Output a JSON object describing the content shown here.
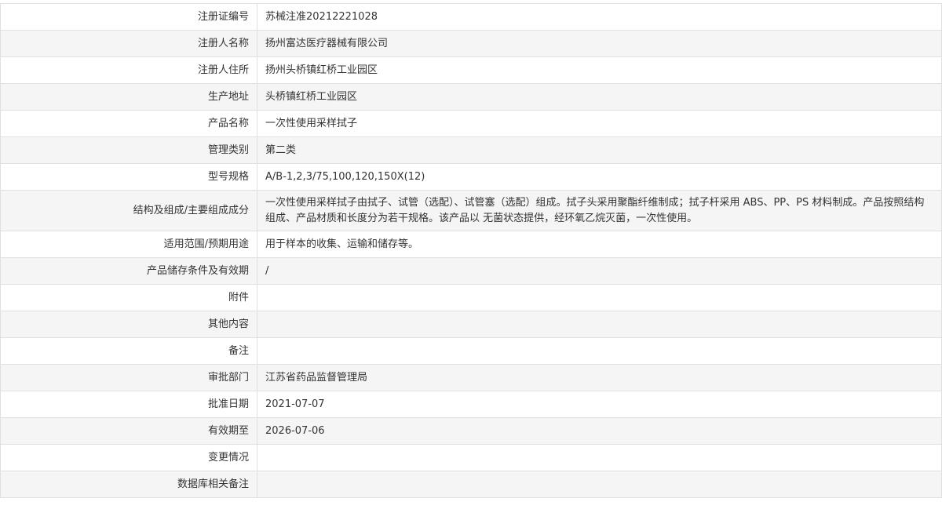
{
  "rows": [
    {
      "label": "注册证编号",
      "value": "苏械注准20212221028"
    },
    {
      "label": "注册人名称",
      "value": "扬州富达医疗器械有限公司"
    },
    {
      "label": "注册人住所",
      "value": "扬州头桥镇红桥工业园区"
    },
    {
      "label": "生产地址",
      "value": "头桥镇红桥工业园区"
    },
    {
      "label": "产品名称",
      "value": "一次性使用采样拭子"
    },
    {
      "label": "管理类别",
      "value": "第二类"
    },
    {
      "label": "型号规格",
      "value": "A/B-1,2,3/75,100,120,150X(12)"
    },
    {
      "label": "结构及组成/主要组成成分",
      "value": "一次性使用采样拭子由拭子、试管（选配）、试管塞（选配）组成。拭子头采用聚酯纤维制成；拭子杆采用 ABS、PP、PS 材料制成。产品按照结构组成、产品材质和长度分为若干规格。该产品以 无菌状态提供，经环氧乙烷灭菌，一次性使用。"
    },
    {
      "label": "适用范围/预期用途",
      "value": "用于样本的收集、运输和储存等。"
    },
    {
      "label": "产品储存条件及有效期",
      "value": "/"
    },
    {
      "label": "附件",
      "value": ""
    },
    {
      "label": "其他内容",
      "value": ""
    },
    {
      "label": "备注",
      "value": ""
    },
    {
      "label": "审批部门",
      "value": "江苏省药品监督管理局"
    },
    {
      "label": "批准日期",
      "value": "2021-07-07"
    },
    {
      "label": "有效期至",
      "value": "2026-07-06"
    },
    {
      "label": "变更情况",
      "value": ""
    },
    {
      "label": "数据库相关备注",
      "value": ""
    }
  ]
}
